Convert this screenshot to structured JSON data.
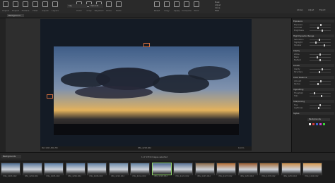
{
  "toolbar": {
    "buttons": [
      {
        "label": "Import"
      },
      {
        "label": "Export"
      },
      {
        "label": "Folders"
      },
      {
        "label": "Filter"
      },
      {
        "label": "Adjust"
      },
      {
        "label": "Layers"
      },
      {
        "label": "Color"
      },
      {
        "label": "Crop"
      },
      {
        "label": "Keyword"
      },
      {
        "label": "Undo"
      },
      {
        "label": "Redo"
      },
      {
        "label": "Reset"
      },
      {
        "label": "Copy"
      },
      {
        "label": "Apply"
      },
      {
        "label": "Compare"
      },
      {
        "label": "Print"
      }
    ],
    "dropdown_left": "Sky",
    "dropdown_mid": "Variants",
    "right_items": [
      "Mask",
      "Adjust",
      "Clone",
      "Heal"
    ],
    "right_tabs": [
      "Library",
      "Adjust",
      "Export"
    ]
  },
  "subbar": {
    "tab_label": "Background"
  },
  "right_panel": {
    "sections": [
      {
        "title": "Exposure"
      },
      {
        "title": "High Dynamic Range"
      },
      {
        "title": "Clarity"
      },
      {
        "title": "Levels"
      },
      {
        "title": "Color Balance"
      },
      {
        "title": "Vignetting"
      },
      {
        "title": "Sharpening"
      },
      {
        "title": "Styles"
      }
    ],
    "rows": [
      {
        "label": "Exposure",
        "value": 0.55
      },
      {
        "label": "Contrast",
        "value": 0.4
      },
      {
        "label": "Brightness",
        "value": 0.6
      },
      {
        "label": "Saturation",
        "value": 0.45
      },
      {
        "label": "Highlight",
        "value": 0.3
      },
      {
        "label": "Shadow",
        "value": 0.7
      },
      {
        "label": "White",
        "value": 0.5
      },
      {
        "label": "Black",
        "value": 0.35
      },
      {
        "label": "Method",
        "value": 0.5
      },
      {
        "label": "Clarity",
        "value": 0.62
      },
      {
        "label": "Structure",
        "value": 0.48
      },
      {
        "label": "Amount",
        "value": 0.52
      },
      {
        "label": "Radius",
        "value": 0.4
      },
      {
        "label": "Threshold",
        "value": 0.2
      },
      {
        "label": "Halo",
        "value": 0.58
      },
      {
        "label": "Hue",
        "value": 0.5
      },
      {
        "label": "Lightness",
        "value": 0.44
      }
    ],
    "style_dropdown": "Backgrounds",
    "swatch_colors": [
      "#e8e8e8",
      "#d43b3b",
      "#3b66d4",
      "#d43bd4",
      "#3bd43b"
    ]
  },
  "photo_info": {
    "left": "ISO 100  1/80s  f/8",
    "center": "IMG_4218.CR2",
    "right": "14mm"
  },
  "filmstrip": {
    "label": "Backgrounds",
    "center_label": "1 of 1749 images selected",
    "thumbs": [
      {
        "caption": "IMG_4203.CR2",
        "tone": "#4f6d90"
      },
      {
        "caption": "IMG_4204.CR2",
        "tone": "#5a7699"
      },
      {
        "caption": "IMG_4205.CR2",
        "tone": "#5d7fa6"
      },
      {
        "caption": "IMG_4206.CR2",
        "tone": "#54759c"
      },
      {
        "caption": "IMG_4208.CR2",
        "tone": "#6280a3"
      },
      {
        "caption": "IMG_4210.CR2",
        "tone": "#6c89a8"
      },
      {
        "caption": "IMG_4214.CR2",
        "tone": "#607f9f"
      },
      {
        "caption": "IMG_4218.CR2",
        "tone": "#4d6690"
      },
      {
        "caption": "IMG_4221.CR2",
        "tone": "#5a7394"
      },
      {
        "caption": "IMG_4225.CR2",
        "tone": "#8a6a4a"
      },
      {
        "caption": "IMG_4227.CR2",
        "tone": "#b46d34"
      },
      {
        "caption": "IMG_4230.CR2",
        "tone": "#9a5c30"
      },
      {
        "caption": "IMG_4233.CR2",
        "tone": "#a06b38"
      },
      {
        "caption": "IMG_4236.CR2",
        "tone": "#c88c48"
      },
      {
        "caption": "IMG_4240.CR2",
        "tone": "#d69a52"
      }
    ],
    "selected_index": 7
  }
}
